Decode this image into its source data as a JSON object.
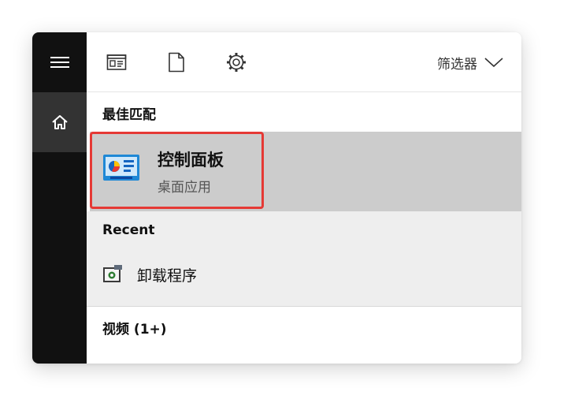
{
  "rail": {
    "menu_icon": "hamburger-menu-icon",
    "home_icon": "home-icon"
  },
  "toolbar": {
    "icons": [
      "apps-icon",
      "documents-icon",
      "settings-icon"
    ],
    "filter_label": "筛选器",
    "filter_icon": "chevron-down-icon"
  },
  "best_match": {
    "header": "最佳匹配",
    "app_title": "控制面板",
    "app_subtitle": "桌面应用",
    "icon": "control-panel-icon"
  },
  "recent": {
    "header": "Recent",
    "items": [
      {
        "label": "卸载程序",
        "icon": "uninstall-program-icon"
      }
    ]
  },
  "videos": {
    "header": "视频 (1+)"
  },
  "colors": {
    "rail_bg": "#111111",
    "rail_active": "#333333",
    "selected_bg": "#cccccc",
    "recent_bg": "#eeeeee",
    "highlight_border": "#e53935"
  }
}
